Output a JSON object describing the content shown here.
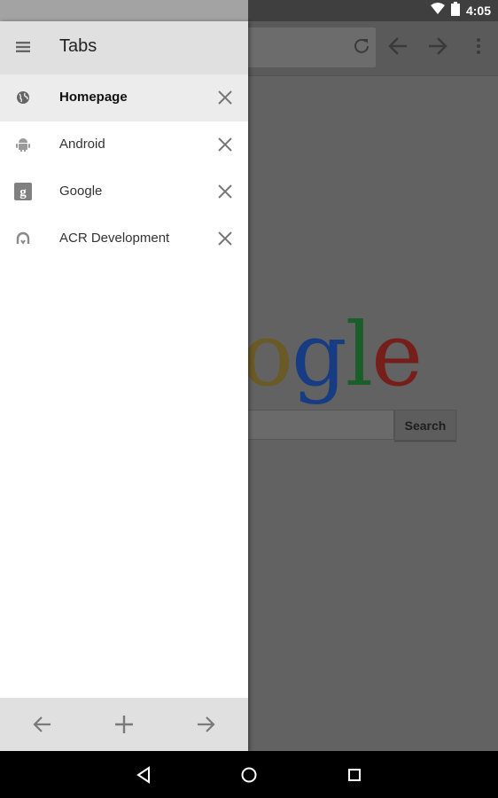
{
  "status_bar": {
    "time": "4:05",
    "icons": [
      "wifi-icon",
      "battery-icon"
    ]
  },
  "browser": {
    "logo_fragments": [
      "o",
      "g",
      "l",
      "e"
    ],
    "search_button": "Search",
    "toolbar_icons": [
      "refresh-icon",
      "back-arrow-icon",
      "forward-arrow-icon",
      "overflow-menu-icon"
    ]
  },
  "drawer": {
    "title": "Tabs",
    "tabs": [
      {
        "label": "Homepage",
        "icon": "globe-icon",
        "active": true
      },
      {
        "label": "Android",
        "icon": "android-icon",
        "active": false
      },
      {
        "label": "Google",
        "icon": "google-g-icon",
        "active": false
      },
      {
        "label": "ACR Development",
        "icon": "acr-icon",
        "active": false
      }
    ],
    "footer_icons": [
      "back-arrow-icon",
      "plus-icon",
      "forward-arrow-icon"
    ]
  },
  "nav_bar": {
    "icons": [
      "back-triangle-icon",
      "home-circle-icon",
      "recents-square-icon"
    ]
  },
  "colors": {
    "drawer_header": "#e0e0e0",
    "active_tab": "#ececec",
    "scrim_background": "#626262"
  }
}
